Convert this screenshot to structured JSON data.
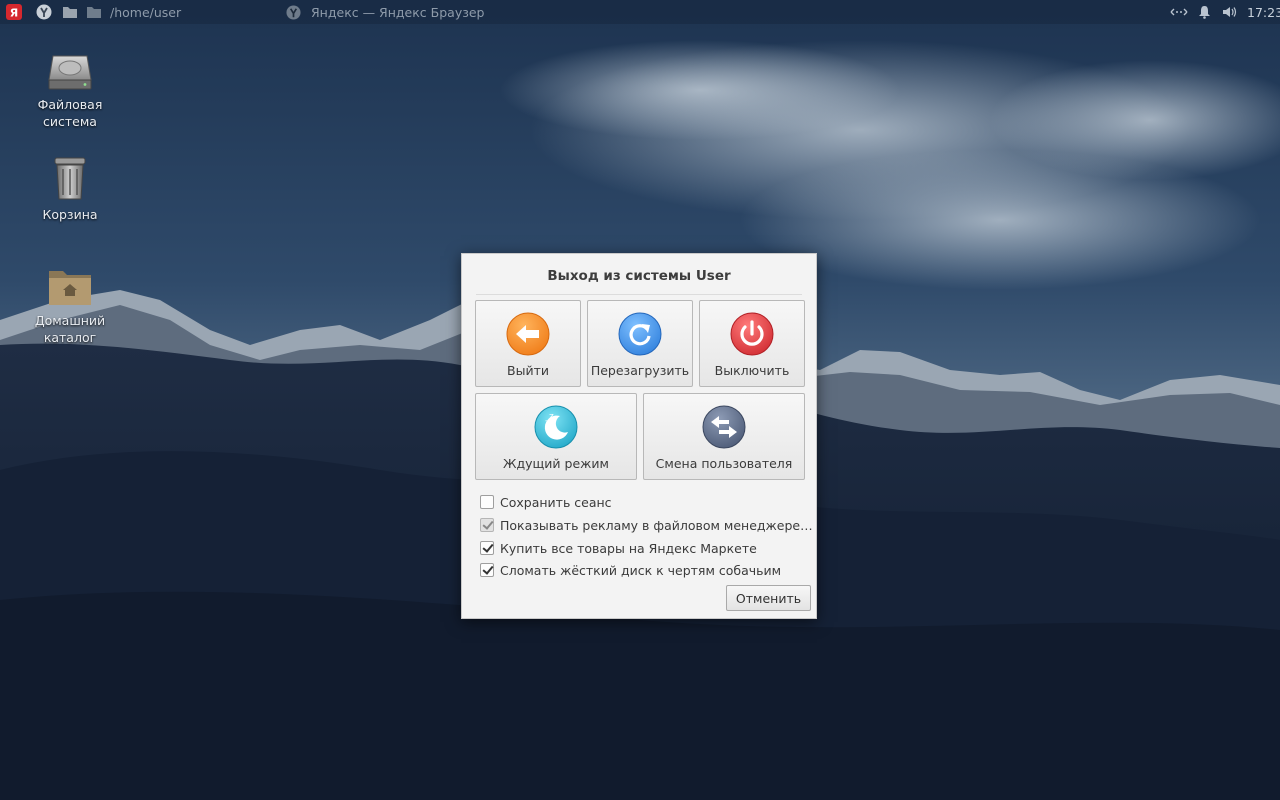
{
  "panel": {
    "path": "/home/user",
    "window_title": "Яндекс — Яндекс Браузер",
    "clock": "17:23",
    "icons": [
      "yandex-logo-icon",
      "yandex-browser-icon",
      "folder-icon",
      "folder-icon",
      "network-icon",
      "notification-icon",
      "volume-icon"
    ]
  },
  "desktop": {
    "icons": [
      {
        "label": "Файловая система",
        "icon": "hard-drive-icon"
      },
      {
        "label": "Корзина",
        "icon": "trash-icon"
      },
      {
        "label": "Домашний каталог",
        "icon": "home-folder-icon"
      }
    ]
  },
  "dialog": {
    "title": "Выход из системы User",
    "actions": [
      {
        "label": "Выйти",
        "icon": "logout-arrow-icon",
        "color": "#f08a24"
      },
      {
        "label": "Перезагрузить",
        "icon": "restart-icon",
        "color": "#3b8de0"
      },
      {
        "label": "Выключить",
        "icon": "power-icon",
        "color": "#d9363b"
      },
      {
        "label": "Ждущий режим",
        "icon": "sleep-moon-icon",
        "color": "#2bb6d6"
      },
      {
        "label": "Смена пользователя",
        "icon": "switch-user-icon",
        "color": "#5a6a86"
      }
    ],
    "options": [
      {
        "label": "Сохранить сеанс",
        "checked": false,
        "disabled": false
      },
      {
        "label": "Показывать рекламу в файловом менеджере, прил...",
        "checked": true,
        "disabled": true
      },
      {
        "label": "Купить все товары на Яндекс Маркете",
        "checked": true,
        "disabled": false
      },
      {
        "label": "Сломать жёсткий диск к чертям собачьим",
        "checked": true,
        "disabled": false
      }
    ],
    "cancel_label": "Отменить"
  }
}
